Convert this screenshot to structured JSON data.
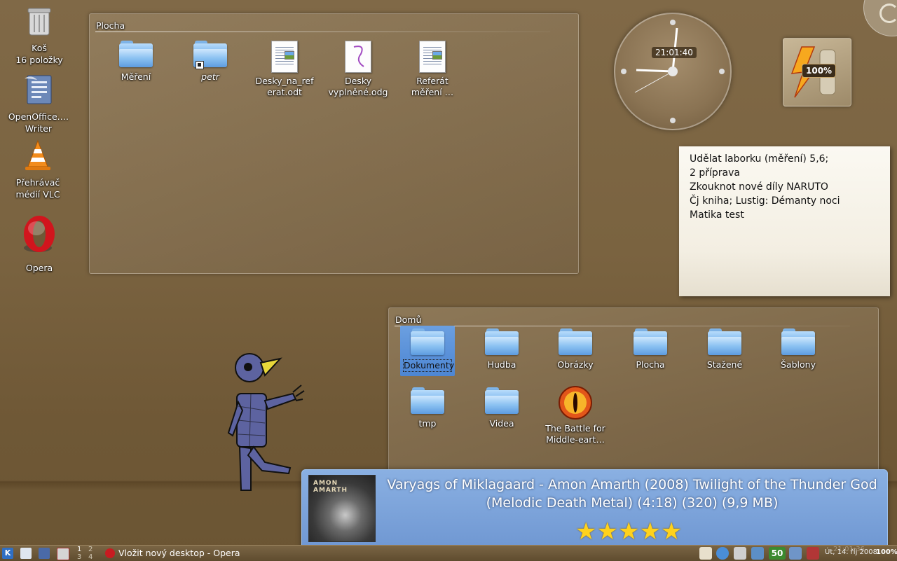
{
  "desktop_icons": [
    {
      "name": "trash",
      "label_line1": "Koš",
      "label_line2": "16 položky"
    },
    {
      "name": "openoffice-writer",
      "label_line1": "OpenOffice.…",
      "label_line2": "Writer"
    },
    {
      "name": "vlc",
      "label_line1": "Přehrávač",
      "label_line2": "médií VLC"
    },
    {
      "name": "opera",
      "label_line1": "Opera",
      "label_line2": ""
    }
  ],
  "plocha_panel": {
    "title": "Plocha",
    "items": [
      {
        "type": "folder",
        "line1": "Měření",
        "line2": ""
      },
      {
        "type": "folder-link",
        "line1": "petr",
        "line2": ""
      },
      {
        "type": "doc",
        "line1": "Desky_na_ref",
        "line2": "erat.odt"
      },
      {
        "type": "draw",
        "line1": "Desky",
        "line2": "vyplněné.odg"
      },
      {
        "type": "doc",
        "line1": "Referát",
        "line2": "měření …"
      }
    ]
  },
  "clock": {
    "time": "21:01:40"
  },
  "battery": {
    "percent": "100%",
    "level": 1.0
  },
  "note": {
    "lines": [
      "Udělat laborku (měření) 5,6;",
      "2 příprava",
      "Zkouknot nové díly NARUTO",
      "Čj kniha; Lustig: Démanty noci",
      "Matika test"
    ]
  },
  "domu_panel": {
    "title": "Domů",
    "items": [
      {
        "line1": "Dokumenty",
        "line2": "",
        "selected": true
      },
      {
        "line1": "Hudba",
        "line2": ""
      },
      {
        "line1": "Obrázky",
        "line2": ""
      },
      {
        "line1": "Plocha",
        "line2": ""
      },
      {
        "line1": "Stažené",
        "line2": ""
      },
      {
        "line1": "Šablony",
        "line2": ""
      },
      {
        "line1": "tmp",
        "line2": ""
      },
      {
        "line1": "Videa",
        "line2": ""
      },
      {
        "line1": "The Battle for",
        "line2": "Middle-eart…"
      }
    ]
  },
  "now_playing": {
    "cover_text": "AMON AMARTH",
    "title_line1": "Varyags of Miklagaard - Amon Amarth (2008) Twilight of the Thunder God",
    "title_line2": "(Melodic Death Metal) (4:18) (320) (9,9 MB)",
    "rating": 5,
    "stars": "★★★★★"
  },
  "taskbar": {
    "pager": [
      "1",
      "2",
      "3",
      "4"
    ],
    "task_label": "Vložit nový desktop - Opera",
    "clock_time": "21:01:36",
    "date": "Út, 14. říj 2008",
    "battery": "100%",
    "tray_counter": "50"
  }
}
